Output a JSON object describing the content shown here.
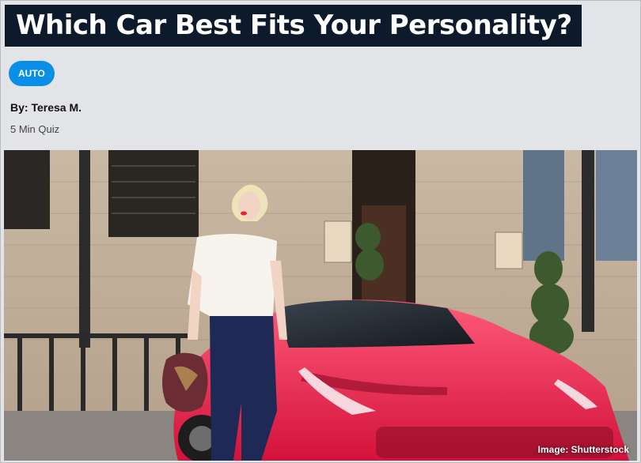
{
  "quiz": {
    "title": "Which Car Best Fits Your Personality?",
    "category_tag": "AUTO",
    "byline": "By: Teresa M.",
    "duration": "5 Min Quiz"
  },
  "hero_image": {
    "credit": "Image: Shutterstock",
    "subject": "woman-standing-beside-red-sports-car"
  },
  "colors": {
    "title_bg": "#0d1a2b",
    "tag_bg": "#0a8fe8",
    "page_bg": "#e3e4e8",
    "car_red": "#e8204a"
  }
}
